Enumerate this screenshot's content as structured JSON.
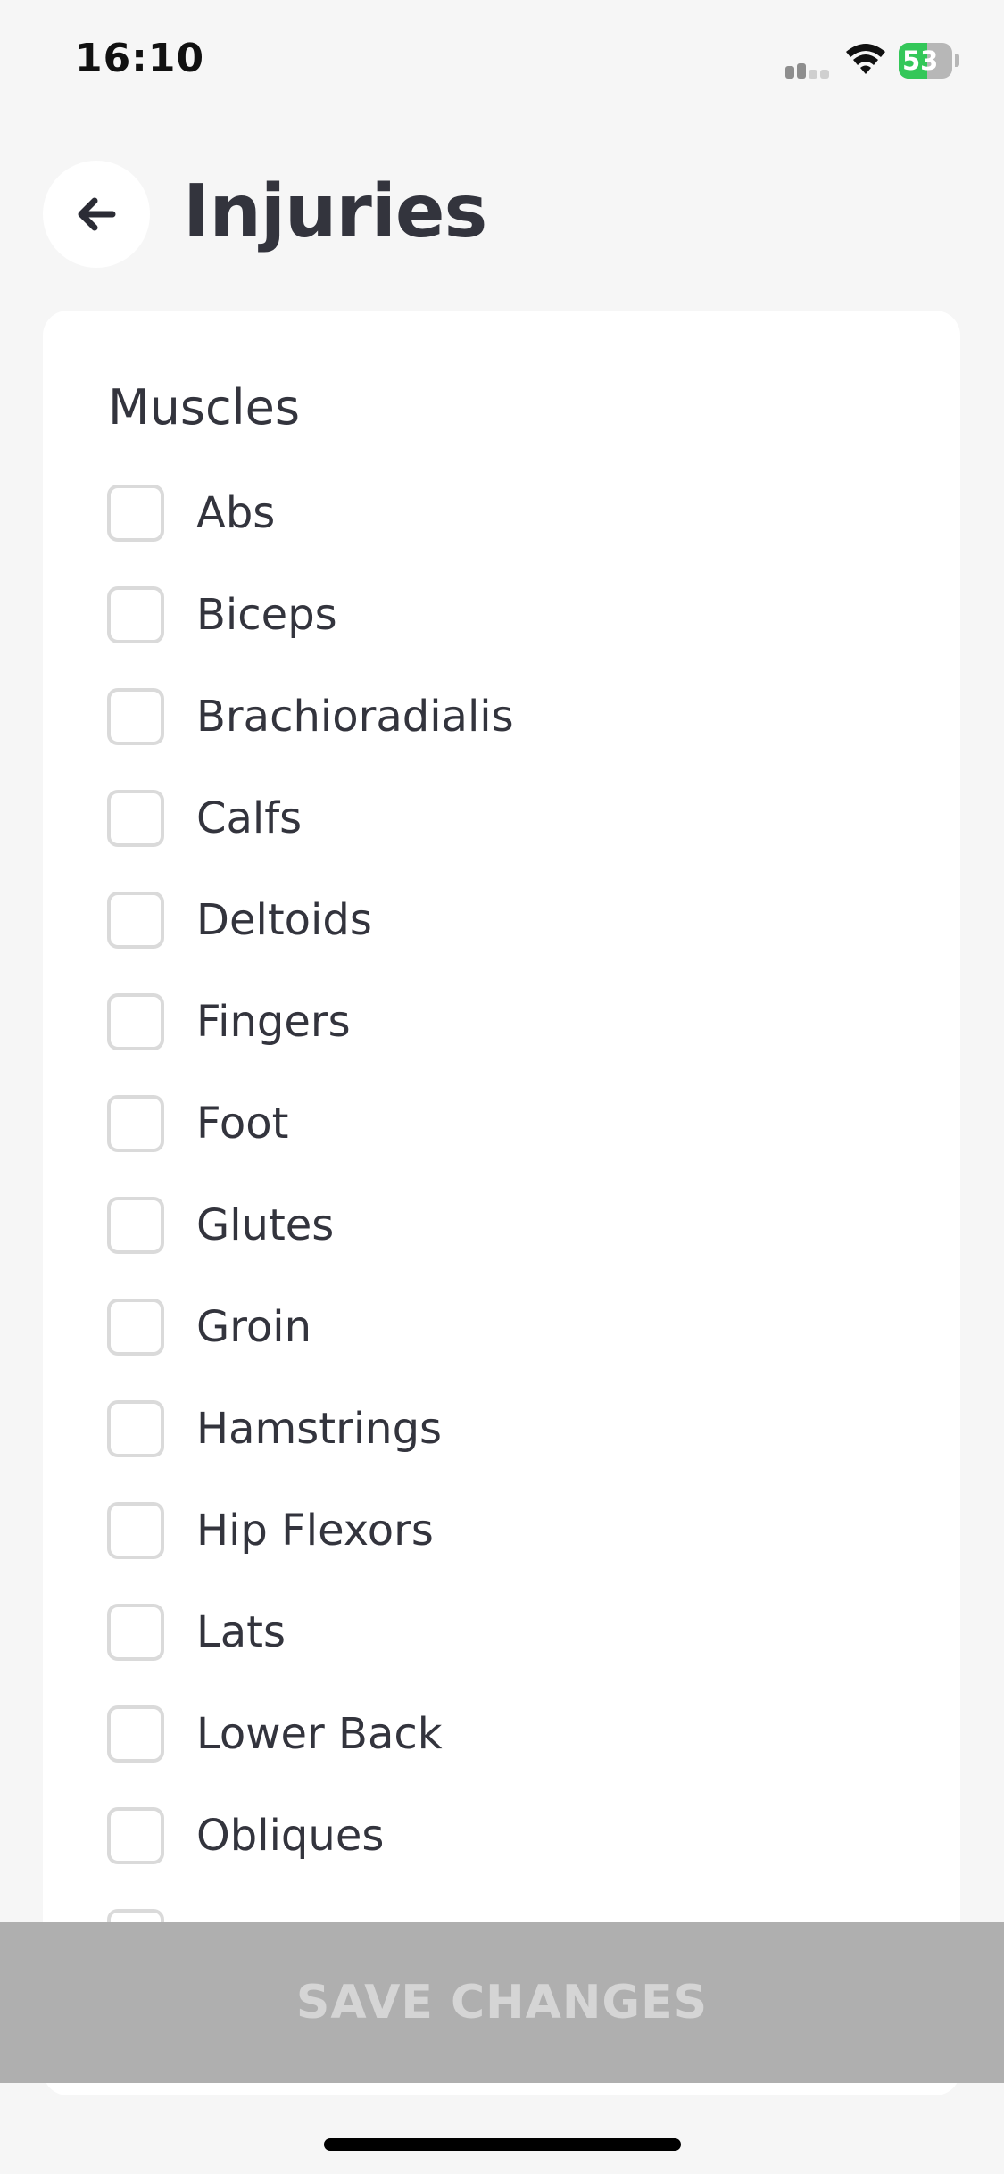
{
  "status_bar": {
    "time": "16:10",
    "battery_percent": "53",
    "battery_level": 0.53
  },
  "header": {
    "title": "Injuries"
  },
  "muscles": {
    "title": "Muscles",
    "items": [
      {
        "label": "Abs",
        "checked": false
      },
      {
        "label": "Biceps",
        "checked": false
      },
      {
        "label": "Brachioradialis",
        "checked": false
      },
      {
        "label": "Calfs",
        "checked": false
      },
      {
        "label": "Deltoids",
        "checked": false
      },
      {
        "label": "Fingers",
        "checked": false
      },
      {
        "label": "Foot",
        "checked": false
      },
      {
        "label": "Glutes",
        "checked": false
      },
      {
        "label": "Groin",
        "checked": false
      },
      {
        "label": "Hamstrings",
        "checked": false
      },
      {
        "label": "Hip Flexors",
        "checked": false
      },
      {
        "label": "Lats",
        "checked": false
      },
      {
        "label": "Lower Back",
        "checked": false
      },
      {
        "label": "Obliques",
        "checked": false
      }
    ]
  },
  "footer": {
    "save_label": "SAVE CHANGES"
  },
  "colors": {
    "text": "#33343d",
    "save_bar": "#afafaf",
    "save_text": "#d5d5d5",
    "battery_green": "#34c759"
  }
}
